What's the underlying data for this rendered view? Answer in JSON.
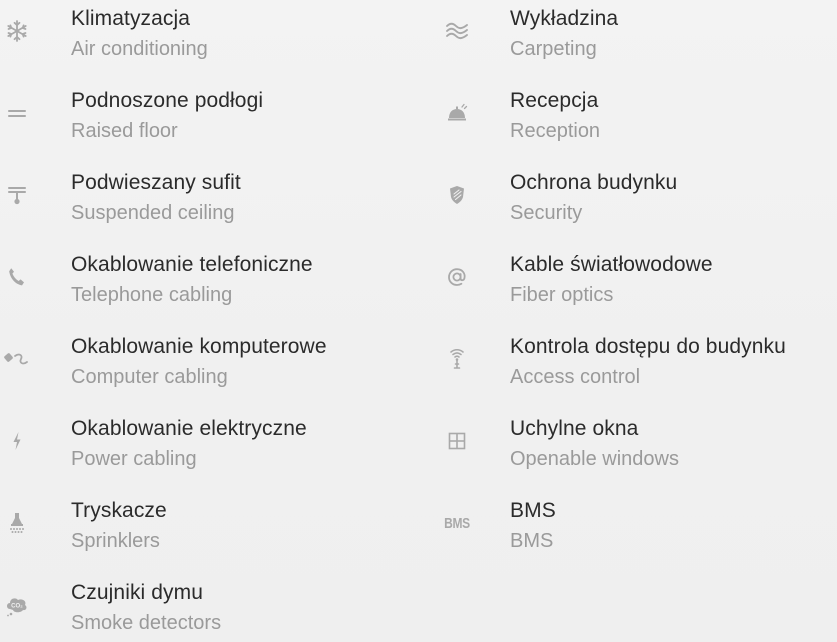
{
  "features": {
    "left": [
      {
        "pl": "Klimatyzacja",
        "en": "Air conditioning",
        "icon": "snowflake-icon"
      },
      {
        "pl": "Podnoszone podłogi",
        "en": "Raised floor",
        "icon": "raised-floor-icon"
      },
      {
        "pl": "Podwieszany sufit",
        "en": "Suspended ceiling",
        "icon": "ceiling-lamp-icon"
      },
      {
        "pl": "Okablowanie telefoniczne",
        "en": "Telephone cabling",
        "icon": "phone-icon"
      },
      {
        "pl": "Okablowanie komputerowe",
        "en": "Computer cabling",
        "icon": "computer-cable-icon"
      },
      {
        "pl": "Okablowanie elektryczne",
        "en": "Power cabling",
        "icon": "lightning-icon"
      },
      {
        "pl": "Tryskacze",
        "en": "Sprinklers",
        "icon": "sprinkler-icon"
      },
      {
        "pl": "Czujniki dymu",
        "en": "Smoke detectors",
        "icon": "smoke-detector-icon"
      }
    ],
    "right": [
      {
        "pl": "Wykładzina",
        "en": "Carpeting",
        "icon": "carpet-waves-icon"
      },
      {
        "pl": "Recepcja",
        "en": "Reception",
        "icon": "reception-bell-icon"
      },
      {
        "pl": "Ochrona budynku",
        "en": "Security",
        "icon": "shield-icon"
      },
      {
        "pl": "Kable światłowodowe",
        "en": "Fiber optics",
        "icon": "at-sign-icon"
      },
      {
        "pl": "Kontrola dostępu do budynku",
        "en": "Access control",
        "icon": "antenna-icon"
      },
      {
        "pl": "Uchylne okna",
        "en": "Openable windows",
        "icon": "window-icon"
      },
      {
        "pl": "BMS",
        "en": "BMS",
        "icon": "bms-icon",
        "icon_text": "BMS"
      }
    ]
  },
  "colors": {
    "background": "#f1f1f1",
    "title_text": "#2b2b2b",
    "subtitle_text": "#9a9a9a",
    "icon": "#a9a9a9"
  }
}
